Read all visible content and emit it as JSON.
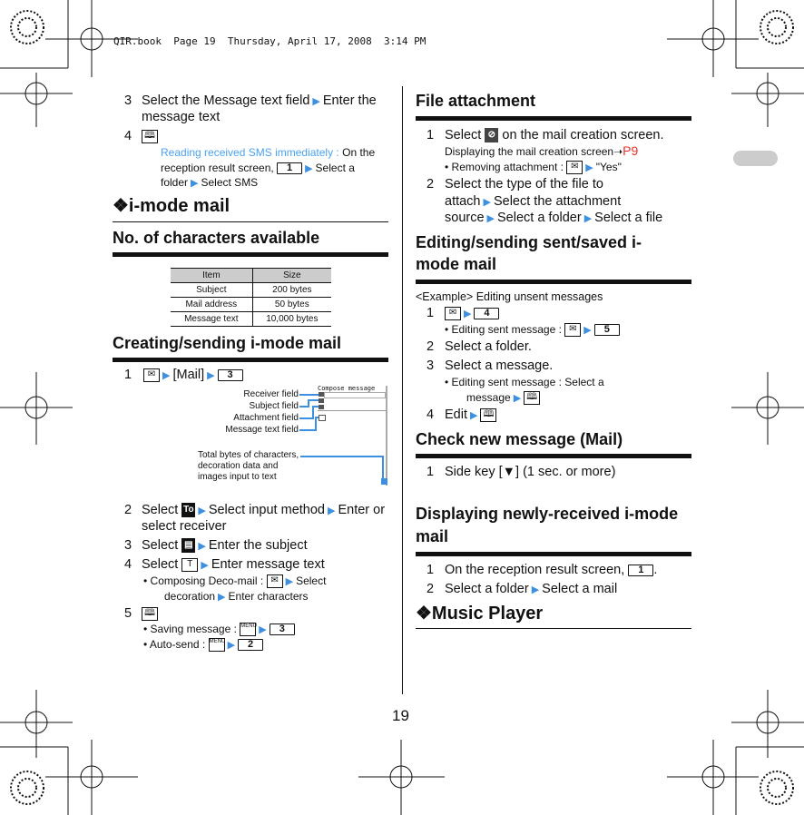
{
  "header": {
    "text": "QIR.book  Page 19  Thursday, April 17, 2008  3:14 PM"
  },
  "page_number": "19",
  "left": {
    "s3": {
      "num": "3",
      "a": "Select the Message text field",
      "b": "Enter the",
      "c": "message text"
    },
    "s4": {
      "num": "4",
      "note_label": "Reading received SMS immediately :",
      "note_a": "On the",
      "note_b": "reception result screen,",
      "key": "1",
      "note_c": "Select a",
      "note_d": "folder",
      "note_e": "Select SMS"
    },
    "imode_title": "❖i-mode mail",
    "chars_title": "No. of characters available",
    "table": {
      "headers": [
        "Item",
        "Size"
      ],
      "rows": [
        [
          "Subject",
          "200 bytes"
        ],
        [
          "Mail address",
          "50 bytes"
        ],
        [
          "Message text",
          "10,000 bytes"
        ]
      ]
    },
    "create_title": "Creating/sending i-mode mail",
    "c1": {
      "num": "1",
      "a": "[Mail]",
      "key": "3"
    },
    "diagram": {
      "screen_title": "Compose message",
      "labels": [
        "Receiver field",
        "Subject field",
        "Attachment field",
        "Message text field"
      ],
      "total": [
        "Total bytes of characters,",
        "decoration data and",
        "images input to text"
      ]
    },
    "c2": {
      "num": "2",
      "a": "Select",
      "icon": "To",
      "b": "Select input method",
      "c": "Enter or",
      "d": "select receiver"
    },
    "c3": {
      "num": "3",
      "a": "Select",
      "b": "Enter the subject"
    },
    "c4": {
      "num": "4",
      "a": "Select",
      "b": "Enter message text",
      "bullet_a": "Composing Deco-mail :",
      "bullet_b": "Select",
      "bullet_c": "decoration",
      "bullet_d": "Enter characters"
    },
    "c5": {
      "num": "5",
      "save": "Saving message :",
      "save_key": "3",
      "auto": "Auto-send :",
      "auto_key": "2",
      "menu": "MENU"
    }
  },
  "right": {
    "file_title": "File attachment",
    "f1": {
      "num": "1",
      "a": "Select",
      "b": "on the mail creation screen.",
      "ref": "Displaying the mail creation screen",
      "ref_arrow": "➝",
      "ref_page": "P9",
      "bullet": "Removing attachment :",
      "yes": "\"Yes\""
    },
    "f2": {
      "num": "2",
      "a": "Select the type of the file to",
      "b": "attach",
      "c": "Select the attachment",
      "d": "source",
      "e": "Select a folder",
      "f": "Select a file"
    },
    "edit_title_a": "Editing/sending sent/saved i-",
    "edit_title_b": "mode mail",
    "example": "<Example>  Editing unsent messages",
    "e1": {
      "num": "1",
      "key": "4",
      "bullet": "Editing sent message :",
      "bullet_key": "5"
    },
    "e2": {
      "num": "2",
      "text": "Select a folder."
    },
    "e3": {
      "num": "3",
      "text": "Select a message.",
      "bullet_a": "Editing sent message : Select a",
      "bullet_b": "message"
    },
    "e4": {
      "num": "4",
      "text": "Edit"
    },
    "check_title": "Check new message (Mail)",
    "k1": {
      "num": "1",
      "text": "Side key [▼] (1 sec. or more)"
    },
    "disp_title_a": "Displaying newly-received i-mode",
    "disp_title_b": "mail",
    "d1": {
      "num": "1",
      "text": "On the reception result screen,",
      "key": "1"
    },
    "d2": {
      "num": "2",
      "a": "Select a folder",
      "b": "Select a mail"
    },
    "music_title": "❖Music Player"
  },
  "colors": {
    "arrow": "#3d8fe0",
    "note": "#4aa3f0",
    "page_ref": "#e8302a",
    "tab": "#cccccc"
  }
}
